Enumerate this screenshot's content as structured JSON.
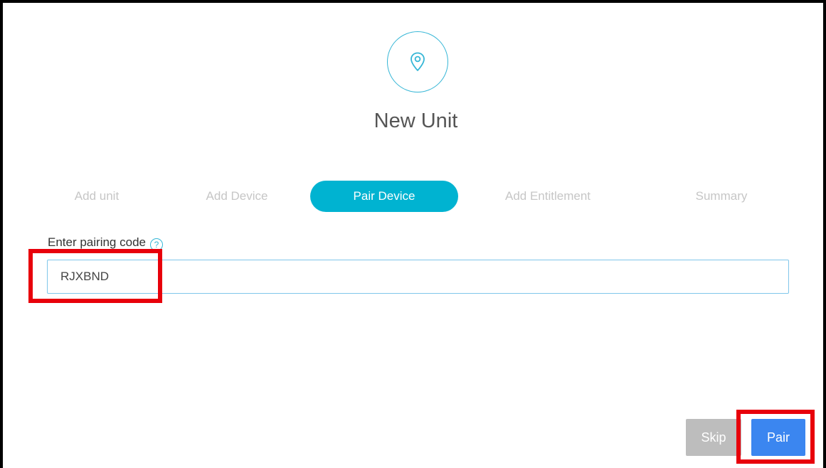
{
  "dialog": {
    "title": "New Unit",
    "icon": "location-pin-icon"
  },
  "stepper": {
    "steps": [
      {
        "label": "Add unit",
        "active": false
      },
      {
        "label": "Add Device",
        "active": false
      },
      {
        "label": "Pair Device",
        "active": true
      },
      {
        "label": "Add Entitlement",
        "active": false
      },
      {
        "label": "Summary",
        "active": false
      }
    ]
  },
  "form": {
    "pairing_code_label": "Enter pairing code",
    "help_icon": "?",
    "pairing_code_value": "RJXBND"
  },
  "actions": {
    "skip_label": "Skip",
    "pair_label": "Pair"
  },
  "colors": {
    "accent": "#00b3d1",
    "primary_button": "#3b86f0",
    "disabled_button": "#bdbdbd",
    "highlight": "#e8000b"
  }
}
